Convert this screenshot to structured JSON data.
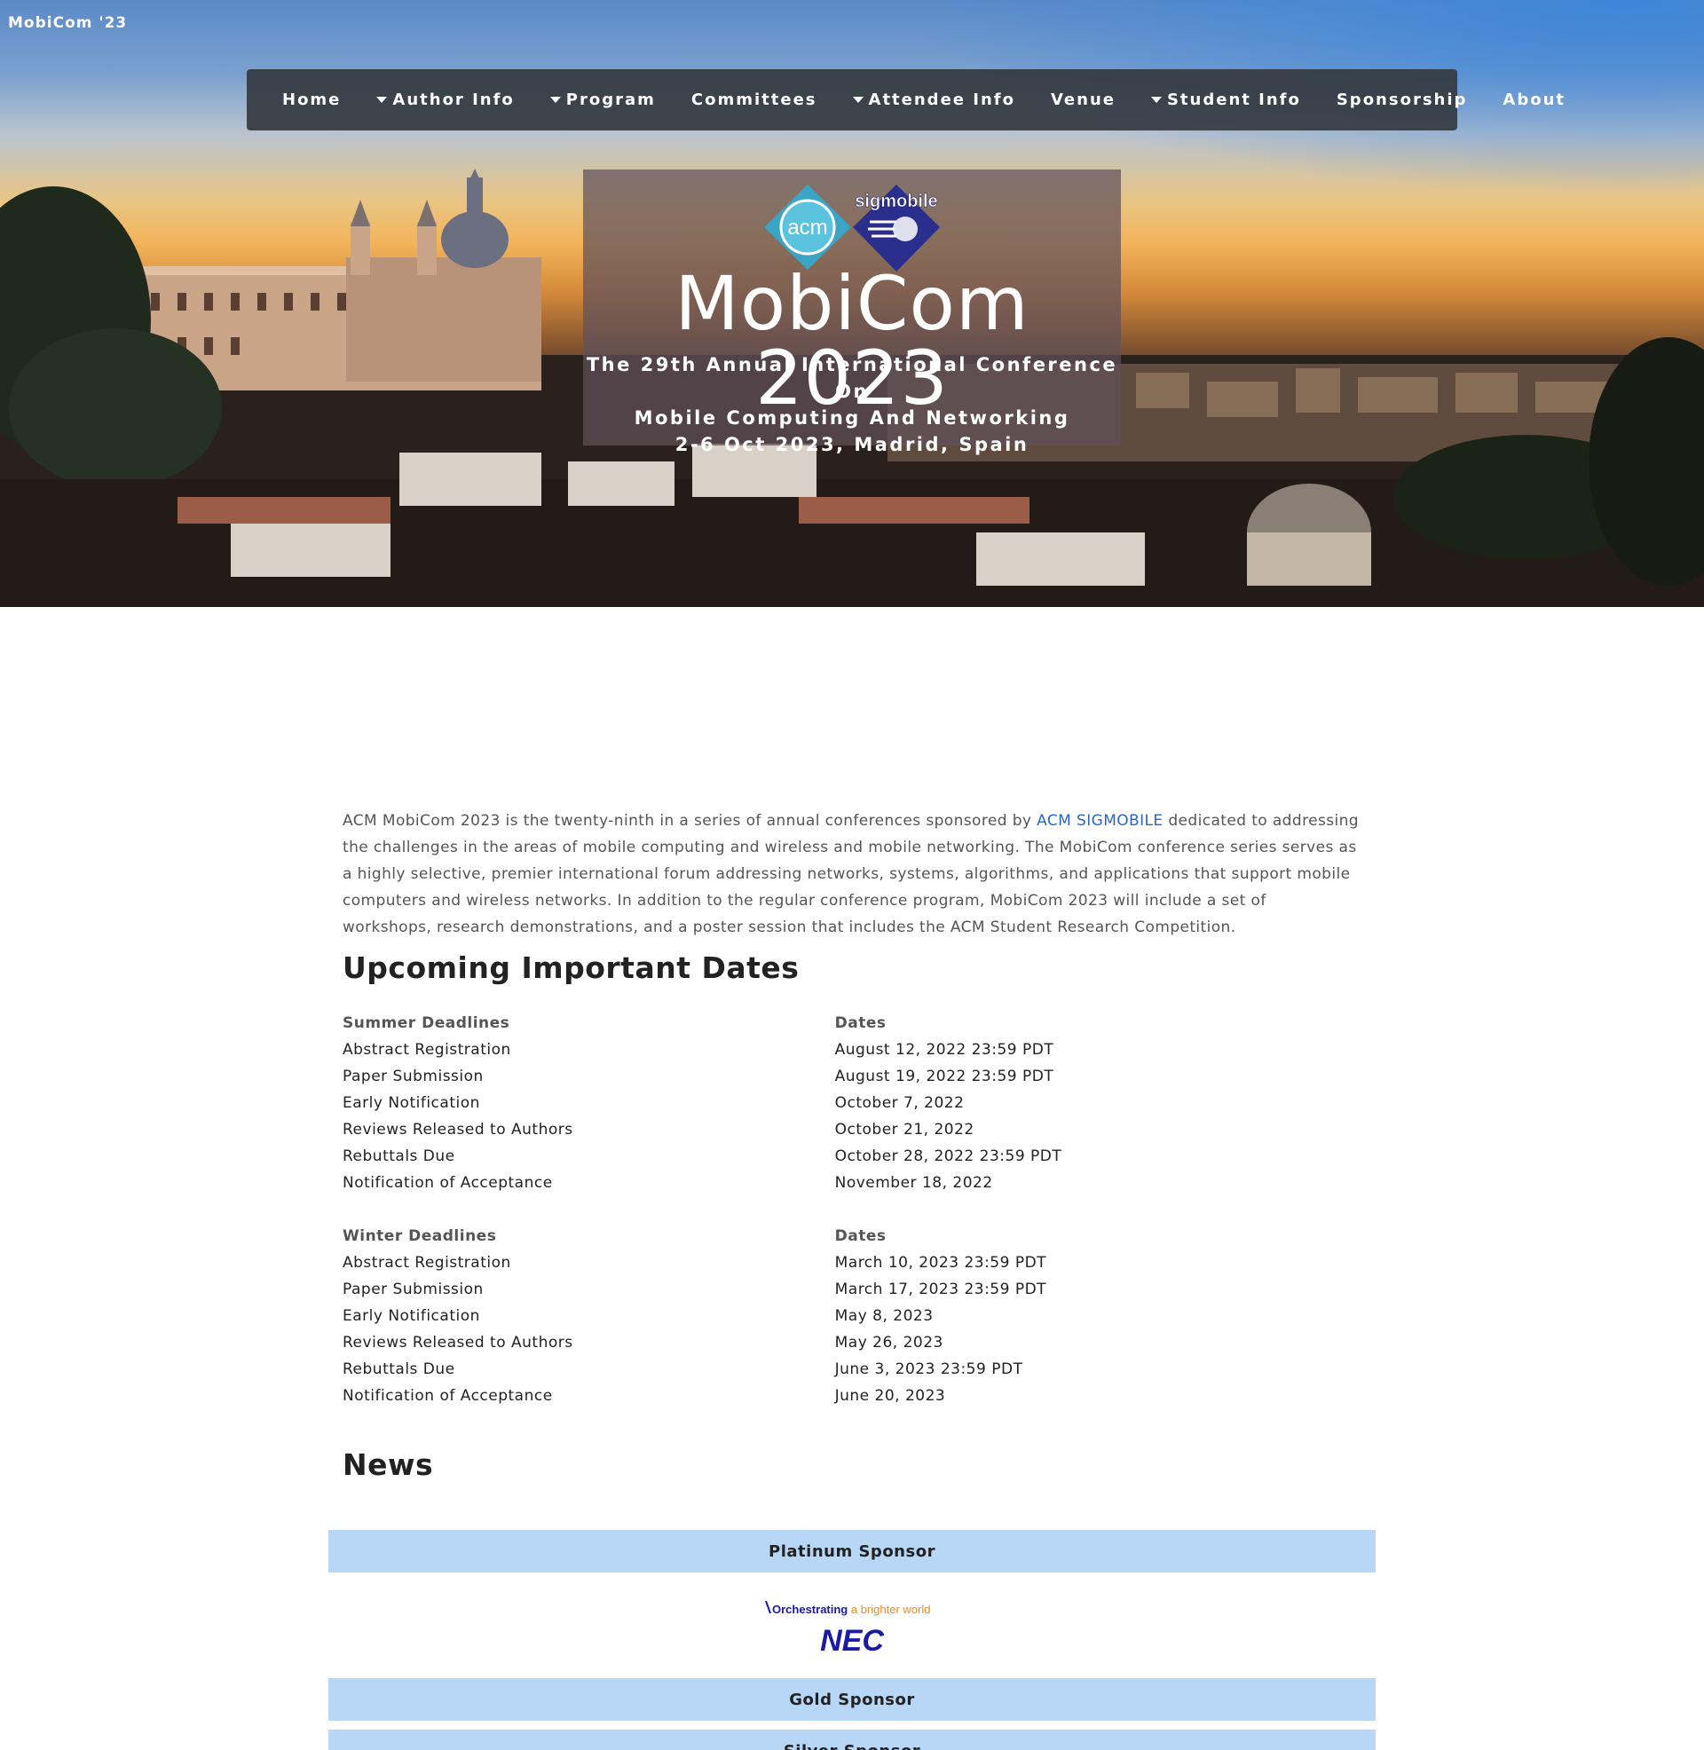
{
  "brand": "MobiCom '23",
  "nav": [
    {
      "label": "Home",
      "dropdown": false
    },
    {
      "label": "Author Info",
      "dropdown": true
    },
    {
      "label": "Program",
      "dropdown": true
    },
    {
      "label": "Committees",
      "dropdown": false
    },
    {
      "label": "Attendee Info",
      "dropdown": true
    },
    {
      "label": "Venue",
      "dropdown": false
    },
    {
      "label": "Student Info",
      "dropdown": true
    },
    {
      "label": "Sponsorship",
      "dropdown": false
    },
    {
      "label": "About",
      "dropdown": false
    }
  ],
  "hero": {
    "logo_acm": "acm",
    "logo_sigmobile": "sigmobile",
    "title": "MobiCom 2023",
    "subtitle_line1": "The 29th Annual International Conference On",
    "subtitle_line2": "Mobile Computing And Networking",
    "subtitle_line3": "2-6 Oct 2023, Madrid, Spain"
  },
  "intro": {
    "before_link": "ACM MobiCom 2023 is the twenty-ninth in a series of annual conferences sponsored by ",
    "link": "ACM SIGMOBILE",
    "after_link": " dedicated to addressing the challenges in the areas of mobile computing and wireless and mobile networking. The MobiCom conference series serves as a highly selective, premier international forum addressing networks, systems, algorithms, and applications that support mobile computers and wireless networks. In addition to the regular conference program, MobiCom 2023 will include a set of workshops, research demonstrations, and a poster session that includes the ACM Student Research Competition."
  },
  "dates_heading": "Upcoming Important Dates",
  "summer": {
    "head1": "Summer Deadlines",
    "head2": "Dates",
    "rows": [
      [
        "Abstract Registration",
        "August 12, 2022 23:59 PDT"
      ],
      [
        "Paper Submission",
        "August 19, 2022 23:59 PDT"
      ],
      [
        "Early Notification",
        "October 7, 2022"
      ],
      [
        "Reviews Released to Authors",
        "October 21, 2022"
      ],
      [
        "Rebuttals Due",
        "October 28, 2022 23:59 PDT"
      ],
      [
        "Notification of Acceptance",
        "November 18, 2022"
      ]
    ]
  },
  "winter": {
    "head1": "Winter Deadlines",
    "head2": "Dates",
    "rows": [
      [
        "Abstract Registration",
        "March 10, 2023 23:59 PDT"
      ],
      [
        "Paper Submission",
        "March 17, 2023 23:59 PDT"
      ],
      [
        "Early Notification",
        "May 8, 2023"
      ],
      [
        "Reviews Released to Authors",
        "May 26, 2023"
      ],
      [
        "Rebuttals Due",
        "June 3, 2023 23:59 PDT"
      ],
      [
        "Notification of Acceptance",
        "June 20, 2023"
      ]
    ]
  },
  "news_heading": "News",
  "sponsors": {
    "platinum": "Platinum Sponsor",
    "gold": "Gold Sponsor",
    "silver": "Silver Sponsor",
    "nec_tagline_a": "Orchestrating",
    "nec_tagline_b": " a brighter world",
    "nec_name": "NEC"
  },
  "colors": {
    "nav_bg": "#343a40",
    "link": "#2a66c8",
    "sponsor_bar": "#b8d6f5",
    "nec_blue": "#1a1aa6",
    "nec_orange": "#f0891e"
  }
}
